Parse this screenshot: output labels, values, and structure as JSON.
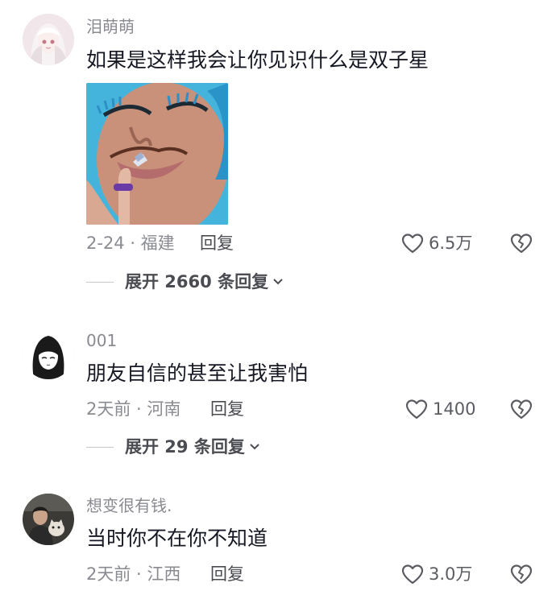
{
  "comments": [
    {
      "username": "泪萌萌",
      "text": "如果是这样我会让你见识什么是双子星",
      "meta": "2-24 · 福建",
      "reply_label": "回复",
      "likes": "6.5万",
      "expand_label": "展开 2660 条回复"
    },
    {
      "username": "001",
      "text": "朋友自信的甚至让我害怕",
      "meta": "2天前 · 河南",
      "reply_label": "回复",
      "likes": "1400",
      "expand_label": "展开 29 条回复"
    },
    {
      "username": "想变很有钱.",
      "text": "当时你不在你不知道",
      "meta": "2天前 · 江西",
      "reply_label": "回复",
      "likes": "3.0万"
    }
  ],
  "colors": {
    "text_primary": "#161823",
    "text_secondary": "#8a8b91",
    "icon": "#5b5c62"
  },
  "icons": {
    "like": "heart-outline-icon",
    "dislike": "broken-heart-icon",
    "expand": "chevron-down-icon"
  }
}
